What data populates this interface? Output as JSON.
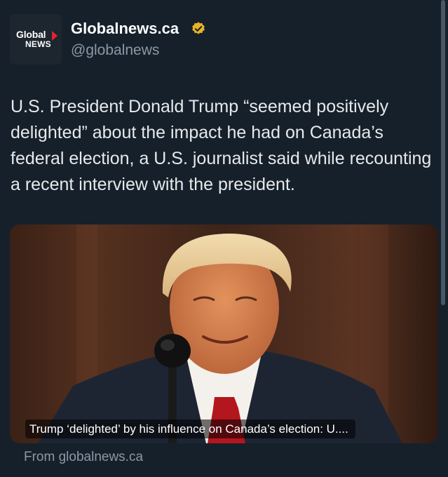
{
  "account": {
    "display_name": "Globalnews.ca",
    "handle": "@globalnews",
    "verified": true,
    "avatar": {
      "logo_word1": "Global",
      "logo_word2": "NEWS",
      "arrow_color": "#e3242b"
    }
  },
  "tweet": {
    "text": "U.S. President Donald Trump “seemed positively delighted” about the impact he had on Canada’s federal election, a U.S. journalist said while recounting a recent interview with the president."
  },
  "link_card": {
    "title": "Trump ‘delighted’ by his influence on Canada’s election: U....",
    "source": "From globalnews.ca",
    "image": "Donald Trump smiling at a podium microphone"
  },
  "colors": {
    "background": "#15202b",
    "text_primary": "#e7e9ea",
    "text_secondary": "#8b98a5",
    "verified_badge": "#e8b423"
  },
  "icons": [
    "verified-badge-icon",
    "global-news-logo"
  ]
}
